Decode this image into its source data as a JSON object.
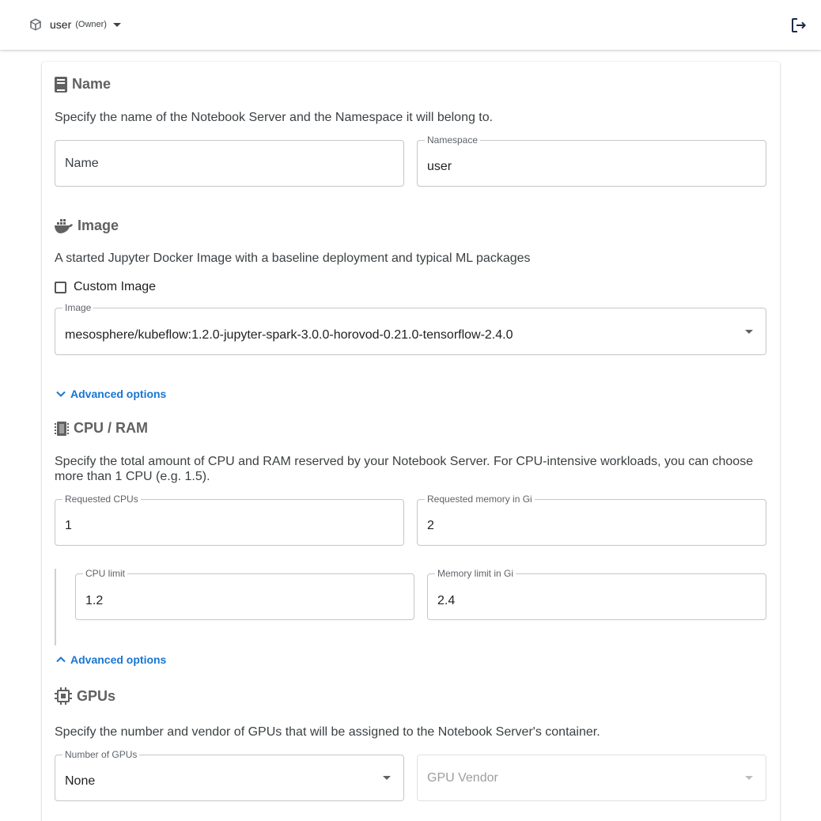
{
  "topbar": {
    "namespace": "user",
    "role": "(Owner)",
    "icons": {
      "namespace": "cube-icon",
      "logout": "logout-icon"
    }
  },
  "name_section": {
    "title": "Name",
    "icon": "book-icon",
    "description": "Specify the name of the Notebook Server and the Namespace it will belong to.",
    "name_field": {
      "placeholder": "Name",
      "value": ""
    },
    "namespace_field": {
      "label": "Namespace",
      "value": "user"
    }
  },
  "image_section": {
    "title": "Image",
    "icon": "docker-icon",
    "description": "A started Jupyter Docker Image with a baseline deployment and typical ML packages",
    "custom_image": {
      "label": "Custom Image",
      "checked": false
    },
    "image_field": {
      "label": "Image",
      "value": "mesosphere/kubeflow:1.2.0-jupyter-spark-3.0.0-horovod-0.21.0-tensorflow-2.4.0"
    },
    "advanced_options": {
      "label": "Advanced options",
      "expanded": false
    }
  },
  "cpu_ram_section": {
    "title": "CPU / RAM",
    "icon": "memory-chip-icon",
    "description_line1": "Specify the total amount of CPU and RAM reserved by your Notebook Server. For CPU-intensive workloads, you can choose",
    "description_line2": "more than 1 CPU (e.g. 1.5).",
    "requested_cpus": {
      "label": "Requested CPUs",
      "value": "1"
    },
    "requested_memory": {
      "label": "Requested memory in Gi",
      "value": "2"
    },
    "cpu_limit": {
      "label": "CPU limit",
      "value": "1.2"
    },
    "memory_limit": {
      "label": "Memory limit in Gi",
      "value": "2.4"
    },
    "advanced_options": {
      "label": "Advanced options",
      "expanded": true
    }
  },
  "gpus_section": {
    "title": "GPUs",
    "icon": "gpu-chip-icon",
    "description": "Specify the number and vendor of GPUs that will be assigned to the Notebook Server's container.",
    "number_of_gpus": {
      "label": "Number of GPUs",
      "value": "None"
    },
    "gpu_vendor": {
      "placeholder": "GPU Vendor",
      "disabled": true
    }
  },
  "colors": {
    "accent": "#1976d2",
    "section_title": "#616161",
    "border": "#c6c6c6"
  }
}
